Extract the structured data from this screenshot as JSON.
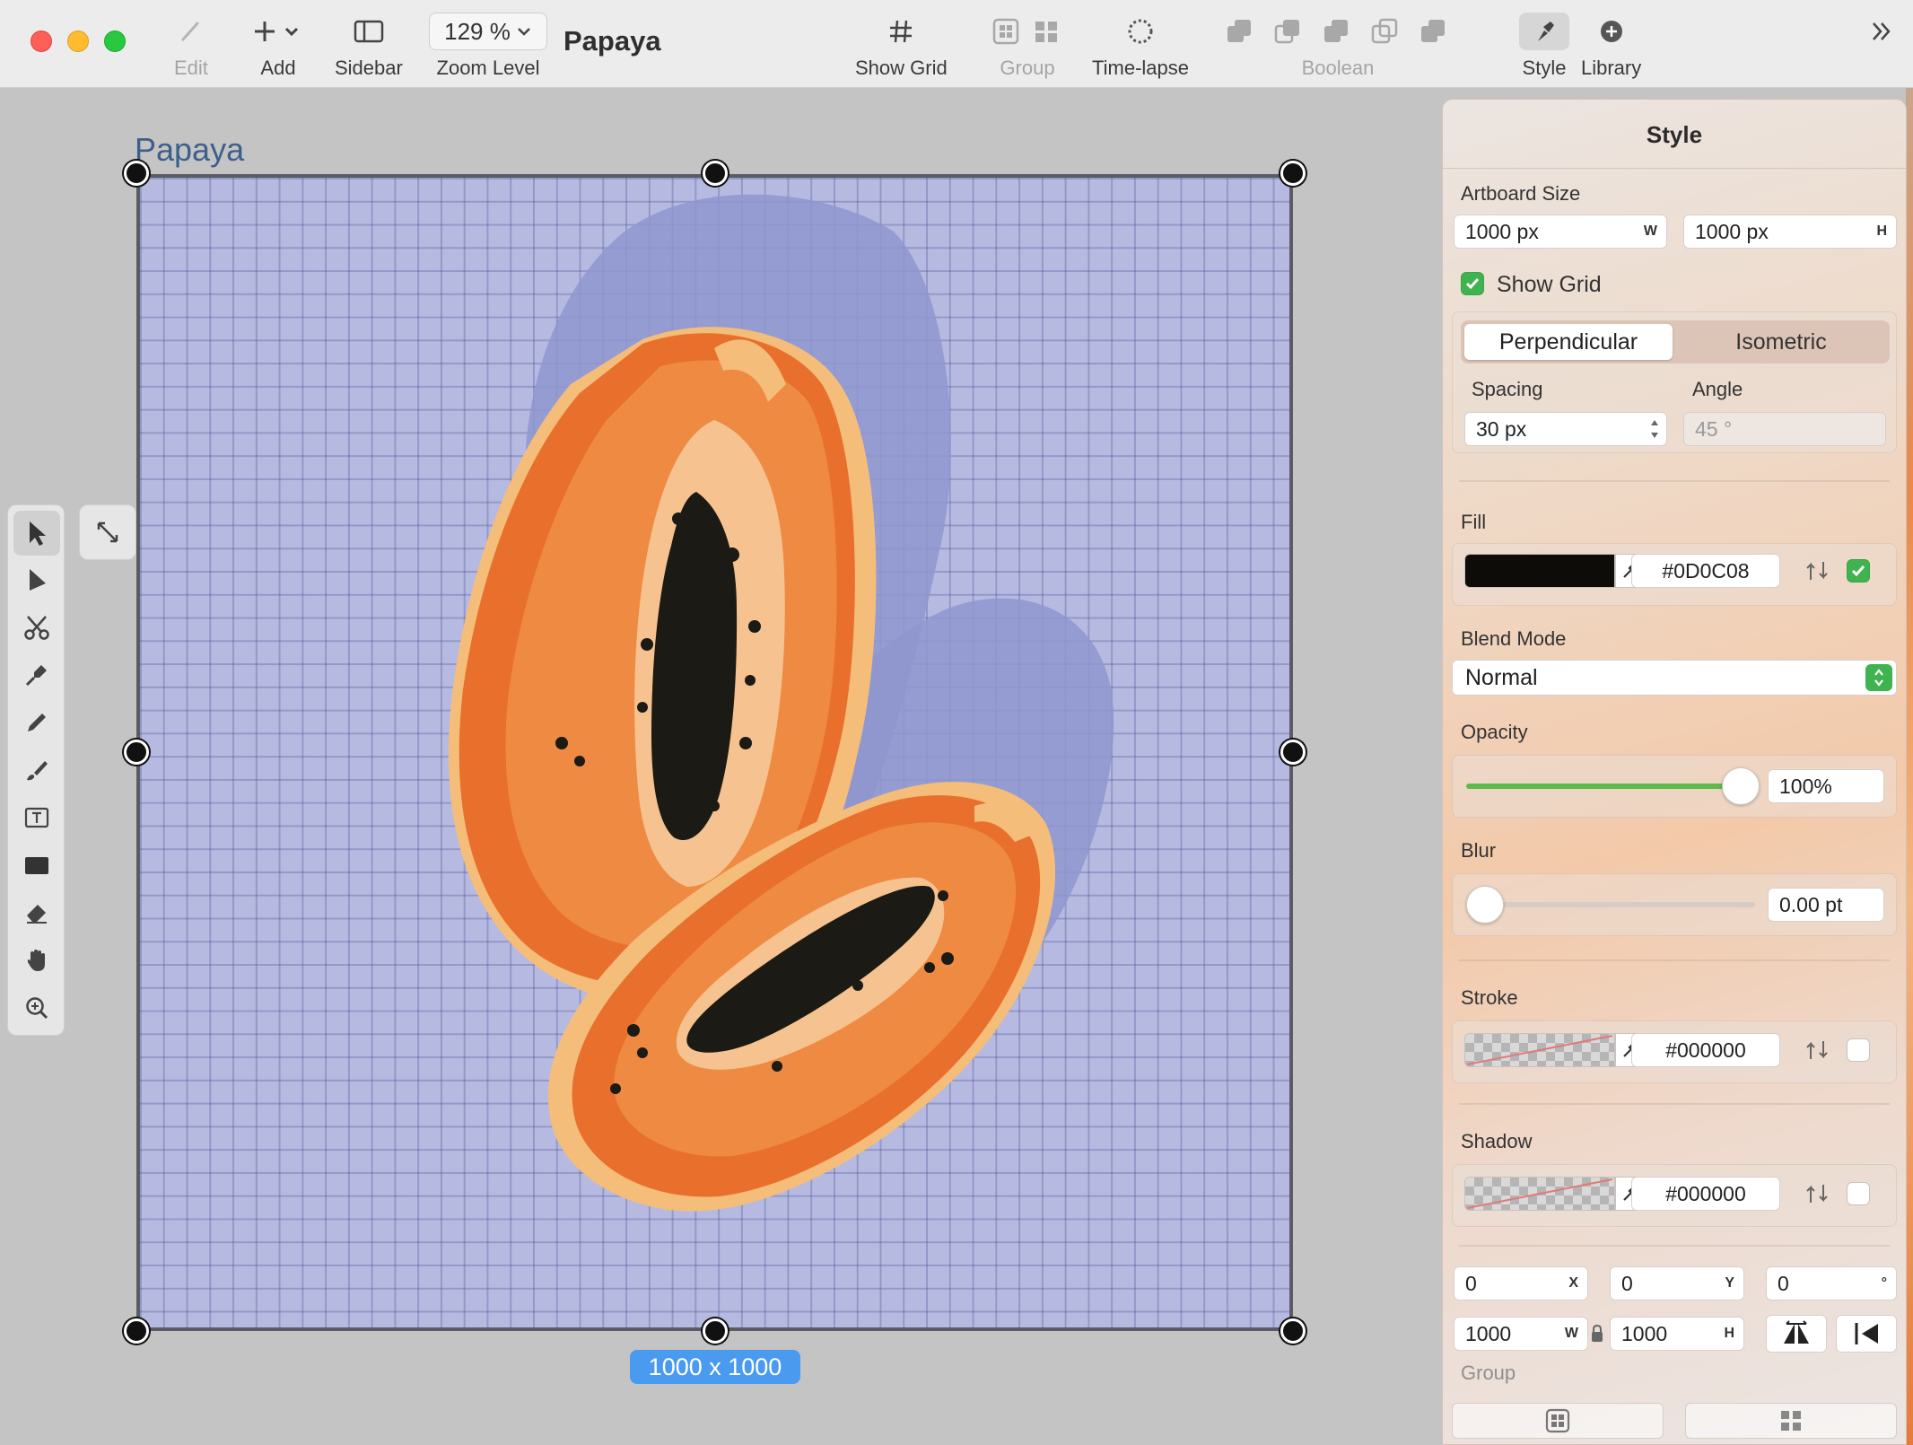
{
  "toolbar": {
    "doc_title": "Papaya",
    "zoom_value": "129 %",
    "items": {
      "edit": "Edit",
      "add": "Add",
      "sidebar": "Sidebar",
      "zoom": "Zoom Level",
      "show_grid": "Show Grid",
      "group": "Group",
      "timelapse": "Time-lapse",
      "boolean": "Boolean",
      "style": "Style",
      "library": "Library"
    }
  },
  "canvas": {
    "artboard_name": "Papaya",
    "size_badge": "1000 x 1000",
    "background_color": "#B7BAE0"
  },
  "tools": [
    "select-arrow-icon",
    "direct-select-icon",
    "scissors-icon",
    "pen-icon",
    "pencil-icon",
    "brush-icon",
    "text-icon",
    "rectangle-icon",
    "eraser-icon",
    "hand-icon",
    "zoom-icon"
  ],
  "panel": {
    "title": "Style",
    "artboard_size": {
      "label": "Artboard Size",
      "width": "1000 px",
      "width_suffix": "W",
      "height": "1000 px",
      "height_suffix": "H"
    },
    "grid": {
      "show_label": "Show Grid",
      "show_checked": true,
      "options": [
        "Perpendicular",
        "Isometric"
      ],
      "selected": "Perpendicular",
      "spacing_label": "Spacing",
      "spacing_value": "30 px",
      "angle_label": "Angle",
      "angle_value": "45 °"
    },
    "fill": {
      "label": "Fill",
      "hex": "#0D0C08",
      "color": "#0D0C08",
      "enabled": true
    },
    "blend": {
      "label": "Blend Mode",
      "value": "Normal"
    },
    "opacity": {
      "label": "Opacity",
      "value": "100%",
      "level": 1.0
    },
    "blur": {
      "label": "Blur",
      "value": "0.00 pt",
      "level": 0.0
    },
    "stroke": {
      "label": "Stroke",
      "hex": "#000000",
      "enabled": false
    },
    "shadow": {
      "label": "Shadow",
      "hex": "#000000",
      "enabled": false
    },
    "transform": {
      "x": "0",
      "x_suffix": "X",
      "y": "0",
      "y_suffix": "Y",
      "rotation": "0",
      "rotation_suffix": "°",
      "w": "1000",
      "w_suffix": "W",
      "h": "1000",
      "h_suffix": "H"
    },
    "group_label": "Group"
  }
}
